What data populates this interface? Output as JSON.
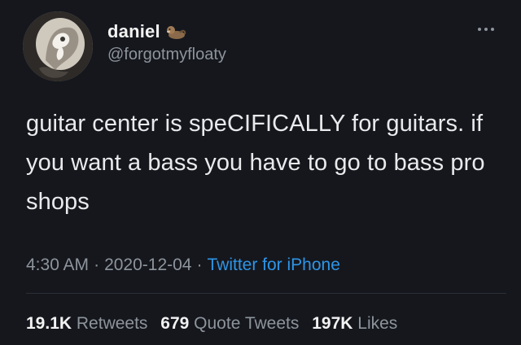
{
  "author": {
    "display_name": "daniel",
    "handle": "@forgotmyfloaty",
    "name_emoji": "otter-emoji"
  },
  "tweet": {
    "text": "guitar center is speCIFICALLY for guitars. if you want a bass you have to go to bass pro shops",
    "time": "4:30 AM",
    "date": "2020-12-04",
    "separator": "·",
    "source": "Twitter for iPhone"
  },
  "stats": {
    "retweets_count": "19.1K",
    "retweets_label": "Retweets",
    "quotes_count": "679",
    "quotes_label": "Quote Tweets",
    "likes_count": "197K",
    "likes_label": "Likes"
  },
  "colors": {
    "background": "#15171d",
    "primary_text": "#e9eaec",
    "secondary_text": "#8d949c",
    "link": "#2e95e6"
  }
}
